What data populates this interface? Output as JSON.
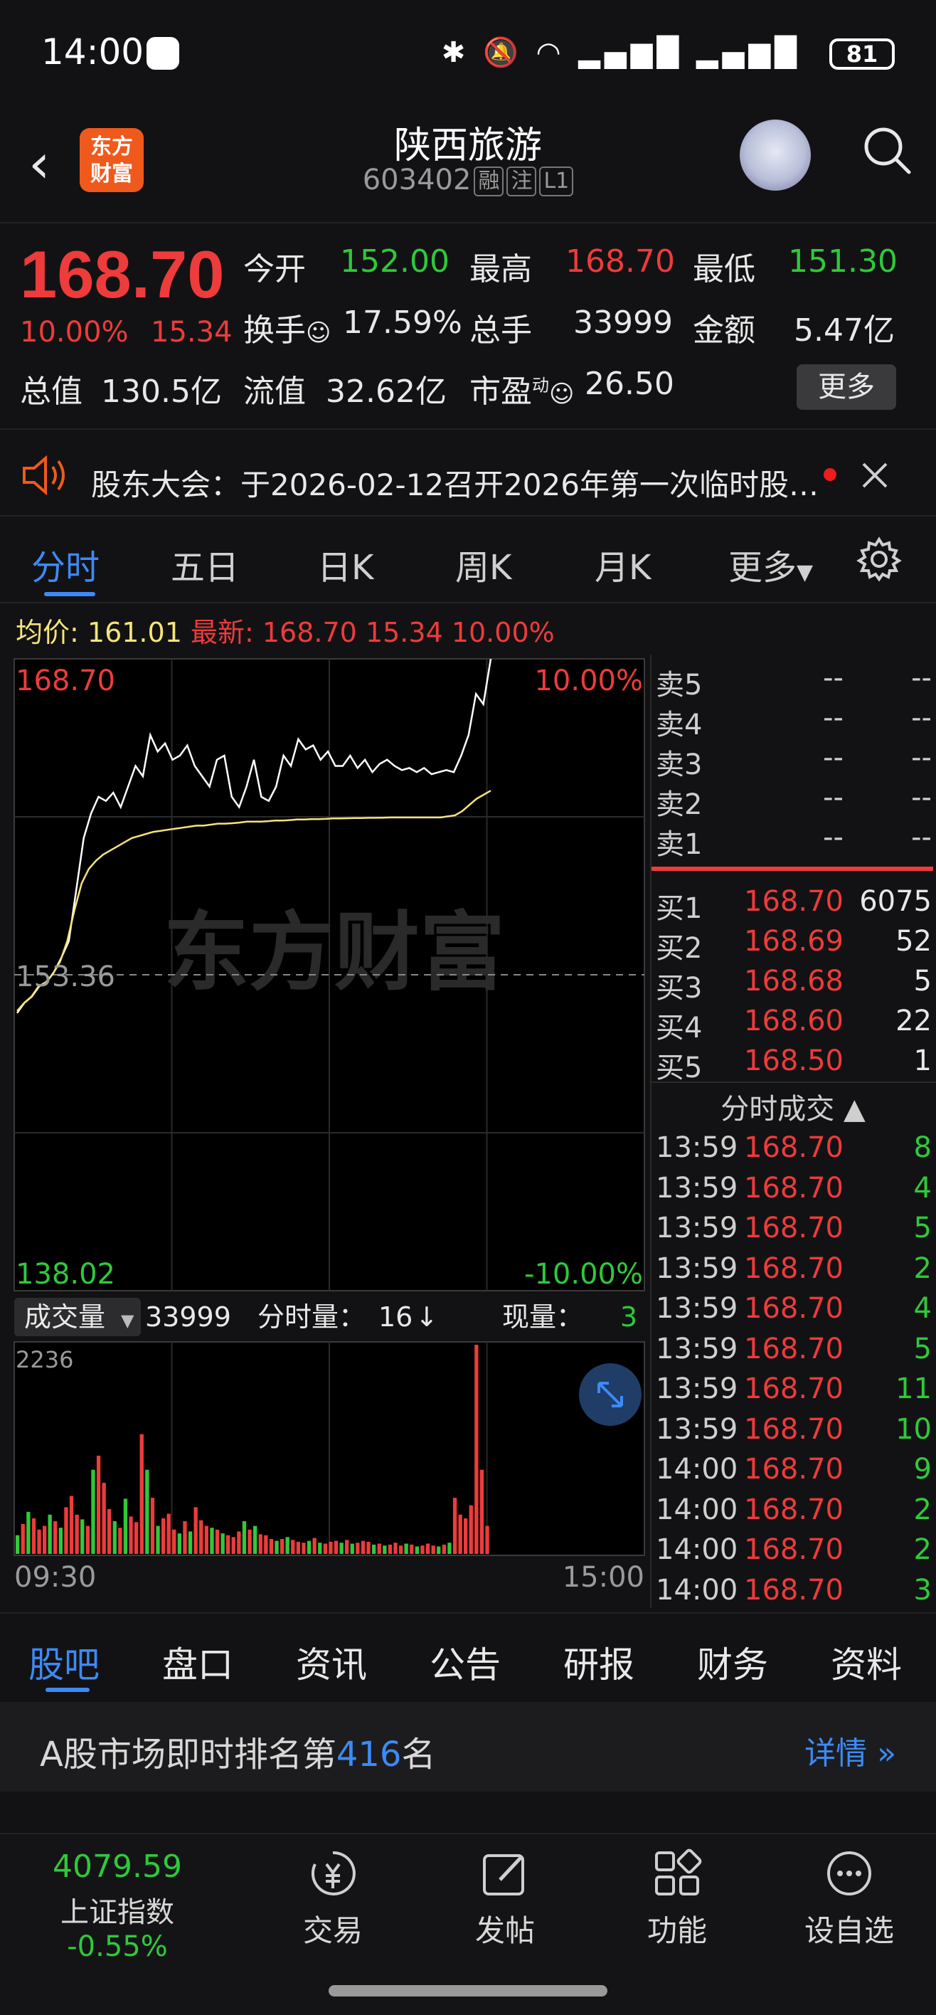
{
  "status_bar": {
    "time": "14:00",
    "battery": "81",
    "icons": [
      "bluetooth-icon",
      "mute-icon",
      "wifi-icon",
      "signal-5a-icon",
      "signal-5a-icon"
    ]
  },
  "header": {
    "logo_line1": "东方",
    "logo_line2": "财富",
    "title": "陕西旅游",
    "code": "603402",
    "tags": [
      "融",
      "注",
      "L1"
    ]
  },
  "quote": {
    "price": "168.70",
    "change_pct": "10.00%",
    "change": "15.34",
    "rows": [
      [
        {
          "label": "今开",
          "value": "152.00",
          "color": "green"
        },
        {
          "label": "最高",
          "value": "168.70",
          "color": "red"
        },
        {
          "label": "最低",
          "value": "151.30",
          "color": "green"
        }
      ],
      [
        {
          "label": "换手",
          "value": "17.59%",
          "color": "white"
        },
        {
          "label": "总手",
          "value": "33999",
          "color": "white"
        },
        {
          "label": "金额",
          "value": "5.47亿",
          "color": "white"
        }
      ],
      [
        {
          "label": "总值",
          "value": "130.5亿",
          "color": "white"
        },
        {
          "label": "流值",
          "value": "32.62亿",
          "color": "white"
        },
        {
          "label": "市盈",
          "value": "26.50",
          "color": "white"
        }
      ]
    ],
    "more": "更多",
    "pe_sup": "动"
  },
  "notice": {
    "text": "股东大会：于2026-02-12召开2026年第一次临时股…"
  },
  "tabs": [
    "分时",
    "五日",
    "日K",
    "周K",
    "月K",
    "更多"
  ],
  "legend": {
    "avg_label": "均价:",
    "avg_value": "161.01",
    "latest_label": "最新:",
    "latest_value": "168.70",
    "latest_change": "15.34",
    "latest_pct": "10.00%"
  },
  "chart_data": {
    "type": "line",
    "ylim": [
      138.02,
      168.7
    ],
    "y_labels": {
      "top": "168.70",
      "mid": "153.36",
      "bottom": "138.02",
      "top_pct": "10.00%",
      "bottom_pct": "-10.00%"
    },
    "watermark": "东方财富",
    "x_labels": [
      "09:30",
      "15:00"
    ],
    "series": [
      {
        "values": [
          151.5,
          152.0,
          152.3,
          152.8,
          153.0,
          153.5,
          154.2,
          155.0,
          157.5,
          160.0,
          161.2,
          162.0,
          161.8,
          162.2,
          161.5,
          162.5,
          163.5,
          163.0,
          165.0,
          164.2,
          164.6,
          163.8,
          164.0,
          164.5,
          163.5,
          163.0,
          162.5,
          163.8,
          164.0,
          162.0,
          161.5,
          162.5,
          163.8,
          162.0,
          161.8,
          162.5,
          164.0,
          163.5,
          164.8,
          164.3,
          164.5,
          163.8,
          164.2,
          163.5,
          163.5,
          164.0,
          163.4,
          163.8,
          163.2,
          163.6,
          163.8,
          163.5,
          163.3,
          163.4,
          163.2,
          163.4,
          163.1,
          163.2,
          163.3,
          163.2,
          164.0,
          165.0,
          167.0,
          166.5,
          168.7
        ]
      },
      {
        "values": [
          151.6,
          152.0,
          152.3,
          152.8,
          153.0,
          153.4,
          154.0,
          155.0,
          156.5,
          157.8,
          158.5,
          158.9,
          159.2,
          159.4,
          159.6,
          159.8,
          160.0,
          160.1,
          160.2,
          160.3,
          160.35,
          160.4,
          160.45,
          160.5,
          160.55,
          160.6,
          160.6,
          160.65,
          160.7,
          160.7,
          160.72,
          160.75,
          160.8,
          160.8,
          160.8,
          160.82,
          160.85,
          160.85,
          160.87,
          160.9,
          160.9,
          160.92,
          160.92,
          160.93,
          160.95,
          160.95,
          160.96,
          160.97,
          160.97,
          160.98,
          160.98,
          160.99,
          161.0,
          161.0,
          161.0,
          161.0,
          161.0,
          161.0,
          161.0,
          161.0,
          161.05,
          161.1,
          161.3,
          161.6,
          161.9,
          162.1,
          162.3
        ]
      }
    ],
    "volume": {
      "label": "成交量",
      "total": "33999",
      "period_label": "分时量：",
      "period_value": "16",
      "current_label": "现量：",
      "current_value": "3",
      "max_label": "2236",
      "bars": [
        200,
        320,
        450,
        380,
        260,
        300,
        420,
        350,
        280,
        500,
        620,
        420,
        370,
        300,
        900,
        1050,
        760,
        480,
        350,
        280,
        590,
        400,
        340,
        1280,
        900,
        600,
        300,
        380,
        430,
        260,
        220,
        350,
        240,
        500,
        360,
        300,
        280,
        260,
        220,
        200,
        180,
        240,
        350,
        260,
        300,
        210,
        200,
        160,
        140,
        160,
        180,
        150,
        130,
        120,
        140,
        170,
        120,
        110,
        130,
        140,
        120,
        150,
        110,
        120,
        140,
        130,
        100,
        110,
        90,
        100,
        120,
        90,
        110,
        100,
        80,
        90,
        110,
        90,
        80,
        100,
        120,
        600,
        420,
        380,
        520,
        2236,
        900,
        300
      ]
    }
  },
  "order_book": {
    "asks": [
      {
        "label": "卖5",
        "price": "--",
        "vol": "--"
      },
      {
        "label": "卖4",
        "price": "--",
        "vol": "--"
      },
      {
        "label": "卖3",
        "price": "--",
        "vol": "--"
      },
      {
        "label": "卖2",
        "price": "--",
        "vol": "--"
      },
      {
        "label": "卖1",
        "price": "--",
        "vol": "--"
      }
    ],
    "bids": [
      {
        "label": "买1",
        "price": "168.70",
        "vol": "6075"
      },
      {
        "label": "买2",
        "price": "168.69",
        "vol": "52"
      },
      {
        "label": "买3",
        "price": "168.68",
        "vol": "5"
      },
      {
        "label": "买4",
        "price": "168.60",
        "vol": "22"
      },
      {
        "label": "买5",
        "price": "168.50",
        "vol": "1"
      }
    ],
    "trades_title": "分时成交",
    "trades": [
      {
        "time": "13:59",
        "price": "168.70",
        "vol": "8"
      },
      {
        "time": "13:59",
        "price": "168.70",
        "vol": "4"
      },
      {
        "time": "13:59",
        "price": "168.70",
        "vol": "5"
      },
      {
        "time": "13:59",
        "price": "168.70",
        "vol": "2"
      },
      {
        "time": "13:59",
        "price": "168.70",
        "vol": "4"
      },
      {
        "time": "13:59",
        "price": "168.70",
        "vol": "5"
      },
      {
        "time": "13:59",
        "price": "168.70",
        "vol": "11"
      },
      {
        "time": "13:59",
        "price": "168.70",
        "vol": "10"
      },
      {
        "time": "14:00",
        "price": "168.70",
        "vol": "9"
      },
      {
        "time": "14:00",
        "price": "168.70",
        "vol": "2"
      },
      {
        "time": "14:00",
        "price": "168.70",
        "vol": "2"
      },
      {
        "time": "14:00",
        "price": "168.70",
        "vol": "3"
      }
    ]
  },
  "sub_tabs": [
    "股吧",
    "盘口",
    "资讯",
    "公告",
    "研报",
    "财务",
    "资料"
  ],
  "rank": {
    "prefix": "A股市场即时排名第",
    "number": "416",
    "suffix": "名",
    "detail": "详情"
  },
  "bottom_nav": {
    "index_value": "4079.59",
    "index_name": "上证指数",
    "index_change": "-0.55%",
    "items": [
      "交易",
      "发帖",
      "功能",
      "设自选"
    ]
  },
  "colors": {
    "up": "#ee3b3b",
    "down": "#2fc93a",
    "accent": "#3d8af7",
    "avg_line": "#f5e47a",
    "background": "#000000"
  }
}
